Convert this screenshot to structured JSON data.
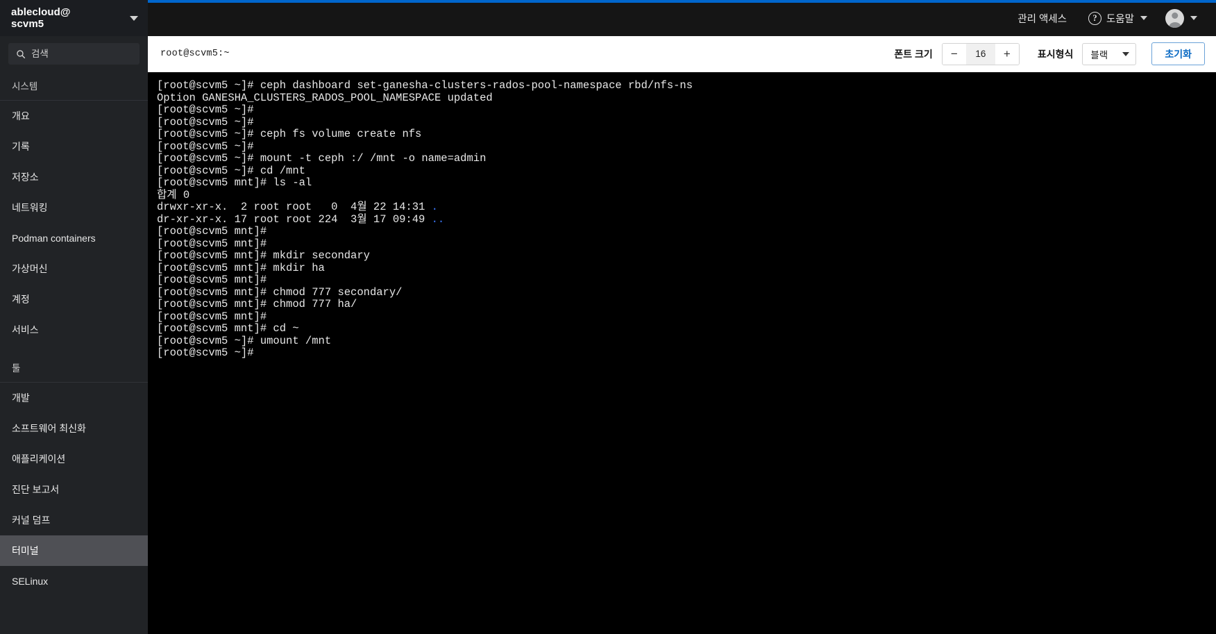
{
  "header": {
    "brand_line1": "ablecloud@",
    "brand_line2": "scvm5",
    "brand_caret_icon": "chevron-down-icon",
    "admin_access_label": "관리 액세스",
    "help_icon": "question-circle-icon",
    "help_label": "도움말",
    "help_caret_icon": "chevron-down-icon",
    "avatar_icon": "user-avatar-icon",
    "user_caret_icon": "chevron-down-icon",
    "accent_color": "#0066cc"
  },
  "sidebar": {
    "search": {
      "placeholder": "검색",
      "value": "",
      "icon": "search-icon"
    },
    "groups": [
      {
        "label": "시스템",
        "items": [
          {
            "label": "개요",
            "active": false
          },
          {
            "label": "기록",
            "active": false
          },
          {
            "label": "저장소",
            "active": false
          },
          {
            "label": "네트워킹",
            "active": false
          },
          {
            "label": "Podman containers",
            "active": false
          },
          {
            "label": "가상머신",
            "active": false
          },
          {
            "label": "계정",
            "active": false
          },
          {
            "label": "서비스",
            "active": false
          }
        ]
      },
      {
        "label": "툴",
        "items": [
          {
            "label": "개발",
            "active": false
          },
          {
            "label": "소프트웨어 최신화",
            "active": false
          },
          {
            "label": "애플리케이션",
            "active": false
          },
          {
            "label": "진단 보고서",
            "active": false
          },
          {
            "label": "커널 덤프",
            "active": false
          },
          {
            "label": "터미널",
            "active": true
          },
          {
            "label": "SELinux",
            "active": false
          }
        ]
      }
    ],
    "active_color": "#4f5055",
    "background_color": "#212326"
  },
  "toolbar": {
    "terminal_title": "root@scvm5:~",
    "font_size_label": "폰트 크기",
    "font_size_decrease": "−",
    "font_size_value": "16",
    "font_size_increase": "+",
    "display_format_label": "표시형식",
    "display_format_value": "블랙",
    "display_format_caret_icon": "chevron-down-icon",
    "reset_label": "초기화",
    "reset_color": "#0a6ac4"
  },
  "terminal": {
    "background_color": "#000000",
    "text_color": "#e8e8e8",
    "dir_color": "#3b78ff",
    "lines": [
      "[root@scvm5 ~]# ceph dashboard set-ganesha-clusters-rados-pool-namespace rbd/nfs-ns",
      "Option GANESHA_CLUSTERS_RADOS_POOL_NAMESPACE updated",
      "[root@scvm5 ~]#",
      "[root@scvm5 ~]#",
      "[root@scvm5 ~]# ceph fs volume create nfs",
      "[root@scvm5 ~]#",
      "[root@scvm5 ~]# mount -t ceph :/ /mnt -o name=admin",
      "[root@scvm5 ~]# cd /mnt",
      "[root@scvm5 mnt]# ls -al",
      "합계 0",
      "drwxr-xr-x.  2 root root   0  4월 22 14:31 §.§",
      "dr-xr-xr-x. 17 root root 224  3월 17 09:49 §..§",
      "[root@scvm5 mnt]#",
      "[root@scvm5 mnt]#",
      "[root@scvm5 mnt]# mkdir secondary",
      "[root@scvm5 mnt]# mkdir ha",
      "[root@scvm5 mnt]#",
      "[root@scvm5 mnt]# chmod 777 secondary/",
      "[root@scvm5 mnt]# chmod 777 ha/",
      "[root@scvm5 mnt]#",
      "[root@scvm5 mnt]# cd ~",
      "[root@scvm5 ~]# umount /mnt",
      "[root@scvm5 ~]#"
    ]
  }
}
